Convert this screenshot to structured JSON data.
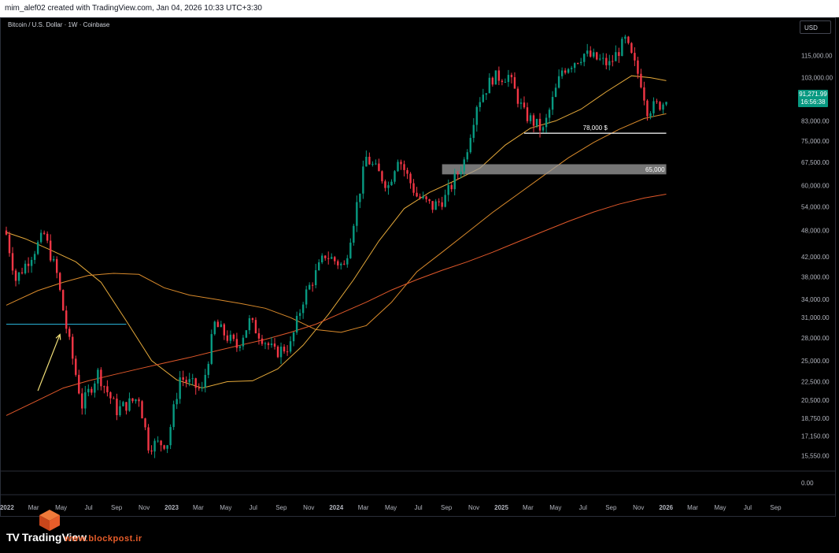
{
  "header": {
    "caption": "mim_alef02 created with TradingView.com, Jan 04, 2026 10:33 UTC+3:30"
  },
  "symbol_title": "Bitcoin / U.S. Dollar · 1W · Coinbase",
  "currency_button": "USD",
  "last_price": {
    "value": "91,271.99",
    "countdown": "16:56:38",
    "color": "#089981"
  },
  "branding": {
    "logo_mark": "TV",
    "logo_text": "TradingView",
    "watermark": "www.blockpost.ir",
    "watermark_color": "#e85d2a"
  },
  "colors": {
    "up": "#089981",
    "down": "#f23645",
    "ma_fast": "#e5a93a",
    "ma_mid": "#d98a2b",
    "ma_slow": "#e0582a",
    "arrow": "#f5e27a",
    "support_line": "#26a7c9",
    "zone": "#9e9e9e"
  },
  "chart_data": {
    "type": "candlestick",
    "scale": "log",
    "y_axis_labels": [
      "115,000.00",
      "103,000.00",
      "83,000.00",
      "75,000.00",
      "67,500.00",
      "60,000.00",
      "54,000.00",
      "48,000.00",
      "42,000.00",
      "38,000.00",
      "34,000.00",
      "31,000.00",
      "28,000.00",
      "25,000.00",
      "22,500.00",
      "20,500.00",
      "18,750.00",
      "17,150.00",
      "15,550.00"
    ],
    "y_axis_values": [
      115000,
      103000,
      83000,
      75000,
      67500,
      60000,
      54000,
      48000,
      42000,
      38000,
      34000,
      31000,
      28000,
      25000,
      22500,
      20500,
      18750,
      17150,
      15550
    ],
    "indicator_axis_label": "0.00",
    "x_axis_labels": [
      "2022",
      "Mar",
      "May",
      "Jul",
      "Sep",
      "Nov",
      "2023",
      "Mar",
      "May",
      "Jul",
      "Sep",
      "Nov",
      "2024",
      "Mar",
      "May",
      "Jul",
      "Sep",
      "Nov",
      "2025",
      "Mar",
      "May",
      "Jul",
      "Sep",
      "Nov",
      "2026",
      "Mar",
      "May",
      "Jul",
      "Sep"
    ],
    "x_start": "2022-01-03",
    "x_end": "2026-10-05",
    "annotations": [
      {
        "type": "hline",
        "label": "78,000 $",
        "price": 78000,
        "from": "2025-02-24",
        "to": "2026-01-05"
      },
      {
        "type": "zone",
        "label": "65,000",
        "price_low": 63500,
        "price_high": 66800,
        "from": "2024-08-26",
        "to": "2026-01-05"
      },
      {
        "type": "hline",
        "label": "",
        "price": 30000,
        "from": "2022-01-03",
        "to": "2022-09-26"
      },
      {
        "type": "arrow",
        "label": "",
        "from_date": "2022-03-14",
        "from_price": 21500,
        "to_date": "2022-05-02",
        "to_price": 28500
      }
    ],
    "moving_averages": [
      {
        "id": "ma_fast",
        "points": [
          [
            "2022-01-03",
            47500
          ],
          [
            "2022-02-14",
            46000
          ],
          [
            "2022-04-11",
            43500
          ],
          [
            "2022-06-06",
            41000
          ],
          [
            "2022-08-01",
            37000
          ],
          [
            "2022-09-26",
            30500
          ],
          [
            "2022-11-21",
            25000
          ],
          [
            "2023-01-16",
            22700
          ],
          [
            "2023-03-13",
            21800
          ],
          [
            "2023-05-08",
            22500
          ],
          [
            "2023-07-03",
            22600
          ],
          [
            "2023-08-28",
            24000
          ],
          [
            "2023-10-23",
            27000
          ],
          [
            "2023-12-18",
            31500
          ],
          [
            "2024-02-12",
            37500
          ],
          [
            "2024-04-08",
            45500
          ],
          [
            "2024-06-03",
            53500
          ],
          [
            "2024-07-29",
            58000
          ],
          [
            "2024-09-23",
            61500
          ],
          [
            "2024-11-18",
            65500
          ],
          [
            "2025-01-13",
            73500
          ],
          [
            "2025-03-10",
            80000
          ],
          [
            "2025-05-05",
            83000
          ],
          [
            "2025-06-30",
            88000
          ],
          [
            "2025-08-25",
            96000
          ],
          [
            "2025-10-20",
            104000
          ],
          [
            "2025-12-01",
            103000
          ],
          [
            "2026-01-05",
            101500
          ]
        ]
      },
      {
        "id": "ma_mid",
        "points": [
          [
            "2022-01-03",
            33000
          ],
          [
            "2022-03-14",
            35500
          ],
          [
            "2022-05-09",
            37000
          ],
          [
            "2022-07-04",
            38300
          ],
          [
            "2022-08-29",
            38700
          ],
          [
            "2022-10-24",
            38500
          ],
          [
            "2022-12-19",
            36000
          ],
          [
            "2023-02-13",
            34700
          ],
          [
            "2023-04-10",
            34000
          ],
          [
            "2023-06-05",
            33300
          ],
          [
            "2023-07-31",
            32500
          ],
          [
            "2023-09-25",
            31000
          ],
          [
            "2023-11-20",
            29200
          ],
          [
            "2024-01-15",
            28800
          ],
          [
            "2024-03-11",
            29800
          ],
          [
            "2024-05-06",
            33500
          ],
          [
            "2024-07-01",
            39000
          ],
          [
            "2024-08-26",
            43000
          ],
          [
            "2024-10-21",
            47500
          ],
          [
            "2024-12-16",
            52500
          ],
          [
            "2025-02-10",
            57500
          ],
          [
            "2025-04-07",
            63000
          ],
          [
            "2025-06-02",
            69000
          ],
          [
            "2025-07-28",
            74500
          ],
          [
            "2025-09-22",
            79500
          ],
          [
            "2025-11-17",
            84000
          ],
          [
            "2026-01-05",
            86000
          ]
        ]
      },
      {
        "id": "ma_slow",
        "points": [
          [
            "2022-01-03",
            19000
          ],
          [
            "2022-03-14",
            20500
          ],
          [
            "2022-05-09",
            21800
          ],
          [
            "2022-07-04",
            22600
          ],
          [
            "2022-08-29",
            23300
          ],
          [
            "2022-10-24",
            24000
          ],
          [
            "2022-12-19",
            24700
          ],
          [
            "2023-02-13",
            25400
          ],
          [
            "2023-04-10",
            26200
          ],
          [
            "2023-06-05",
            27000
          ],
          [
            "2023-07-31",
            27800
          ],
          [
            "2023-09-25",
            28800
          ],
          [
            "2023-11-20",
            30000
          ],
          [
            "2024-01-15",
            31700
          ],
          [
            "2024-03-11",
            33500
          ],
          [
            "2024-05-06",
            35600
          ],
          [
            "2024-07-01",
            37500
          ],
          [
            "2024-08-26",
            39300
          ],
          [
            "2024-10-21",
            41000
          ],
          [
            "2024-12-16",
            43000
          ],
          [
            "2025-02-10",
            45300
          ],
          [
            "2025-04-07",
            47700
          ],
          [
            "2025-06-02",
            50200
          ],
          [
            "2025-07-28",
            52600
          ],
          [
            "2025-09-22",
            54700
          ],
          [
            "2025-11-17",
            56400
          ],
          [
            "2026-01-05",
            57500
          ]
        ]
      }
    ],
    "keyframes": [
      [
        "2022-01-03",
        47000
      ],
      [
        "2022-01-24",
        37500
      ],
      [
        "2022-03-28",
        47000
      ],
      [
        "2022-04-25",
        38500
      ],
      [
        "2022-05-16",
        29500
      ],
      [
        "2022-06-20",
        20000
      ],
      [
        "2022-07-25",
        23500
      ],
      [
        "2022-09-05",
        19500
      ],
      [
        "2022-10-24",
        20800
      ],
      [
        "2022-11-14",
        16400
      ],
      [
        "2022-12-26",
        16600
      ],
      [
        "2023-01-23",
        23000
      ],
      [
        "2023-03-13",
        21500
      ],
      [
        "2023-04-10",
        30000
      ],
      [
        "2023-05-29",
        26800
      ],
      [
        "2023-06-26",
        30400
      ],
      [
        "2023-08-21",
        26000
      ],
      [
        "2023-09-25",
        27000
      ],
      [
        "2023-10-23",
        34000
      ],
      [
        "2023-12-11",
        42500
      ],
      [
        "2024-01-22",
        40000
      ],
      [
        "2024-03-11",
        69000
      ],
      [
        "2024-04-29",
        60000
      ],
      [
        "2024-05-20",
        69500
      ],
      [
        "2024-07-01",
        57000
      ],
      [
        "2024-08-05",
        54000
      ],
      [
        "2024-09-02",
        56500
      ],
      [
        "2024-10-14",
        68000
      ],
      [
        "2024-11-11",
        90500
      ],
      [
        "2024-12-16",
        103000
      ],
      [
        "2025-01-20",
        104000
      ],
      [
        "2025-02-24",
        86000
      ],
      [
        "2025-04-07",
        79000
      ],
      [
        "2025-05-19",
        107000
      ],
      [
        "2025-07-07",
        116000
      ],
      [
        "2025-09-01",
        110000
      ],
      [
        "2025-10-06",
        124000
      ],
      [
        "2025-11-10",
        101000
      ],
      [
        "2025-11-24",
        88000
      ],
      [
        "2026-01-05",
        91272
      ]
    ]
  }
}
